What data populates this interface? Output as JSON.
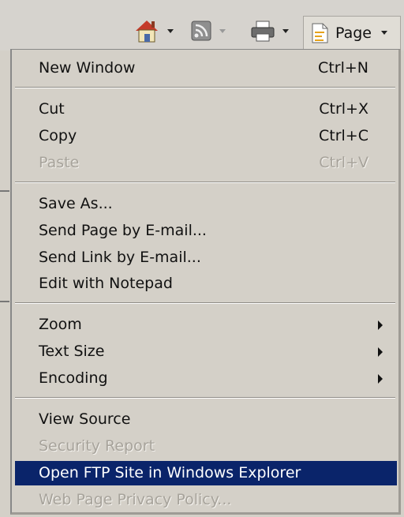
{
  "toolbar": {
    "page_label": "Page",
    "icons": [
      "home-icon",
      "feeds-icon",
      "print-icon",
      "page-icon"
    ]
  },
  "menu": {
    "items": [
      {
        "label": "New Window",
        "shortcut": "Ctrl+N",
        "enabled": true
      },
      {
        "label": "Cut",
        "shortcut": "Ctrl+X",
        "enabled": true
      },
      {
        "label": "Copy",
        "shortcut": "Ctrl+C",
        "enabled": true
      },
      {
        "label": "Paste",
        "shortcut": "Ctrl+V",
        "enabled": false
      },
      {
        "label": "Save As...",
        "enabled": true
      },
      {
        "label": "Send Page by E-mail...",
        "enabled": true
      },
      {
        "label": "Send Link by E-mail...",
        "enabled": true
      },
      {
        "label": "Edit with Notepad",
        "enabled": true
      },
      {
        "label": "Zoom",
        "submenu": true,
        "enabled": true
      },
      {
        "label": "Text Size",
        "submenu": true,
        "enabled": true
      },
      {
        "label": "Encoding",
        "submenu": true,
        "enabled": true
      },
      {
        "label": "View Source",
        "enabled": true
      },
      {
        "label": "Security Report",
        "enabled": false
      },
      {
        "label": "Open FTP Site in Windows Explorer",
        "enabled": true,
        "selected": true
      },
      {
        "label": "Web Page Privacy Policy...",
        "enabled": false
      }
    ]
  },
  "colors": {
    "menu_bg": "#d4d0c8",
    "highlight": "#0a246a",
    "disabled_text": "#a7a39b"
  }
}
